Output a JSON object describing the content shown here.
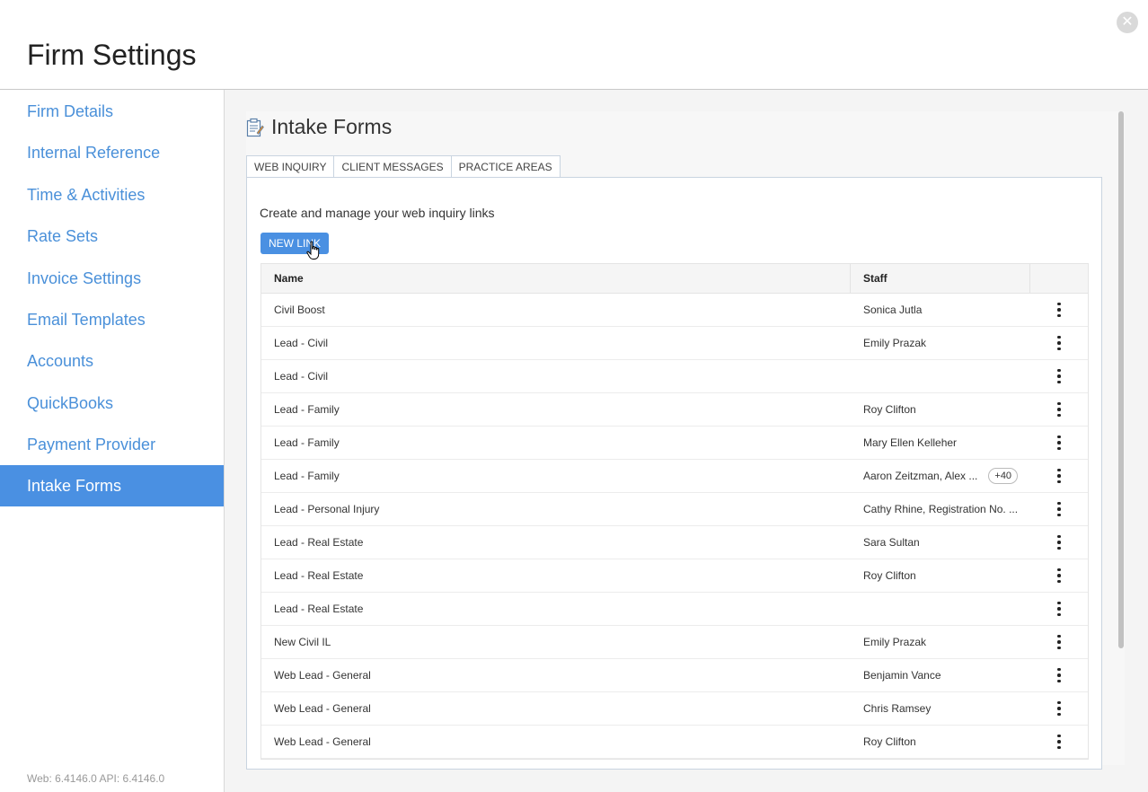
{
  "header": {
    "title": "Firm Settings"
  },
  "sidebar": {
    "items": [
      {
        "label": "Firm Details",
        "active": false
      },
      {
        "label": "Internal Reference",
        "active": false
      },
      {
        "label": "Time & Activities",
        "active": false
      },
      {
        "label": "Rate Sets",
        "active": false
      },
      {
        "label": "Invoice Settings",
        "active": false
      },
      {
        "label": "Email Templates",
        "active": false
      },
      {
        "label": "Accounts",
        "active": false
      },
      {
        "label": "QuickBooks",
        "active": false
      },
      {
        "label": "Payment Provider",
        "active": false
      },
      {
        "label": "Intake Forms",
        "active": true
      }
    ],
    "version": "Web: 6.4146.0 API: 6.4146.0"
  },
  "main": {
    "section_title": "Intake Forms",
    "tabs": [
      {
        "label": "WEB INQUIRY",
        "active": true
      },
      {
        "label": "CLIENT MESSAGES",
        "active": false
      },
      {
        "label": "PRACTICE AREAS",
        "active": false
      }
    ],
    "description": "Create and manage your web inquiry links",
    "new_link_label": "NEW LINK",
    "table": {
      "columns": {
        "name": "Name",
        "staff": "Staff"
      },
      "rows": [
        {
          "name": "Civil Boost",
          "staff": "Sonica Jutla",
          "badge": ""
        },
        {
          "name": "Lead - Civil",
          "staff": "Emily Prazak",
          "badge": ""
        },
        {
          "name": "Lead - Civil",
          "staff": "",
          "badge": ""
        },
        {
          "name": "Lead - Family",
          "staff": "Roy Clifton",
          "badge": ""
        },
        {
          "name": "Lead - Family",
          "staff": "Mary Ellen Kelleher",
          "badge": ""
        },
        {
          "name": "Lead - Family",
          "staff": "Aaron Zeitzman, Alex ...",
          "badge": "+40"
        },
        {
          "name": "Lead - Personal Injury",
          "staff": "Cathy Rhine, Registration No. ...",
          "badge": ""
        },
        {
          "name": "Lead - Real Estate",
          "staff": "Sara Sultan",
          "badge": ""
        },
        {
          "name": "Lead - Real Estate",
          "staff": "Roy Clifton",
          "badge": ""
        },
        {
          "name": "Lead - Real Estate",
          "staff": "",
          "badge": ""
        },
        {
          "name": "New Civil IL",
          "staff": "Emily Prazak",
          "badge": ""
        },
        {
          "name": "Web Lead - General",
          "staff": "Benjamin Vance",
          "badge": ""
        },
        {
          "name": "Web Lead - General",
          "staff": "Chris Ramsey",
          "badge": ""
        },
        {
          "name": "Web Lead - General",
          "staff": "Roy Clifton",
          "badge": ""
        }
      ]
    }
  },
  "colors": {
    "accent": "#4a90e2",
    "nav_text": "#4a90d9",
    "close_icon": "#d9d9d9"
  },
  "icons": {
    "close": "close-icon",
    "form": "form-icon",
    "kebab": "kebab-menu-icon",
    "cursor": "hand-pointer-icon"
  }
}
